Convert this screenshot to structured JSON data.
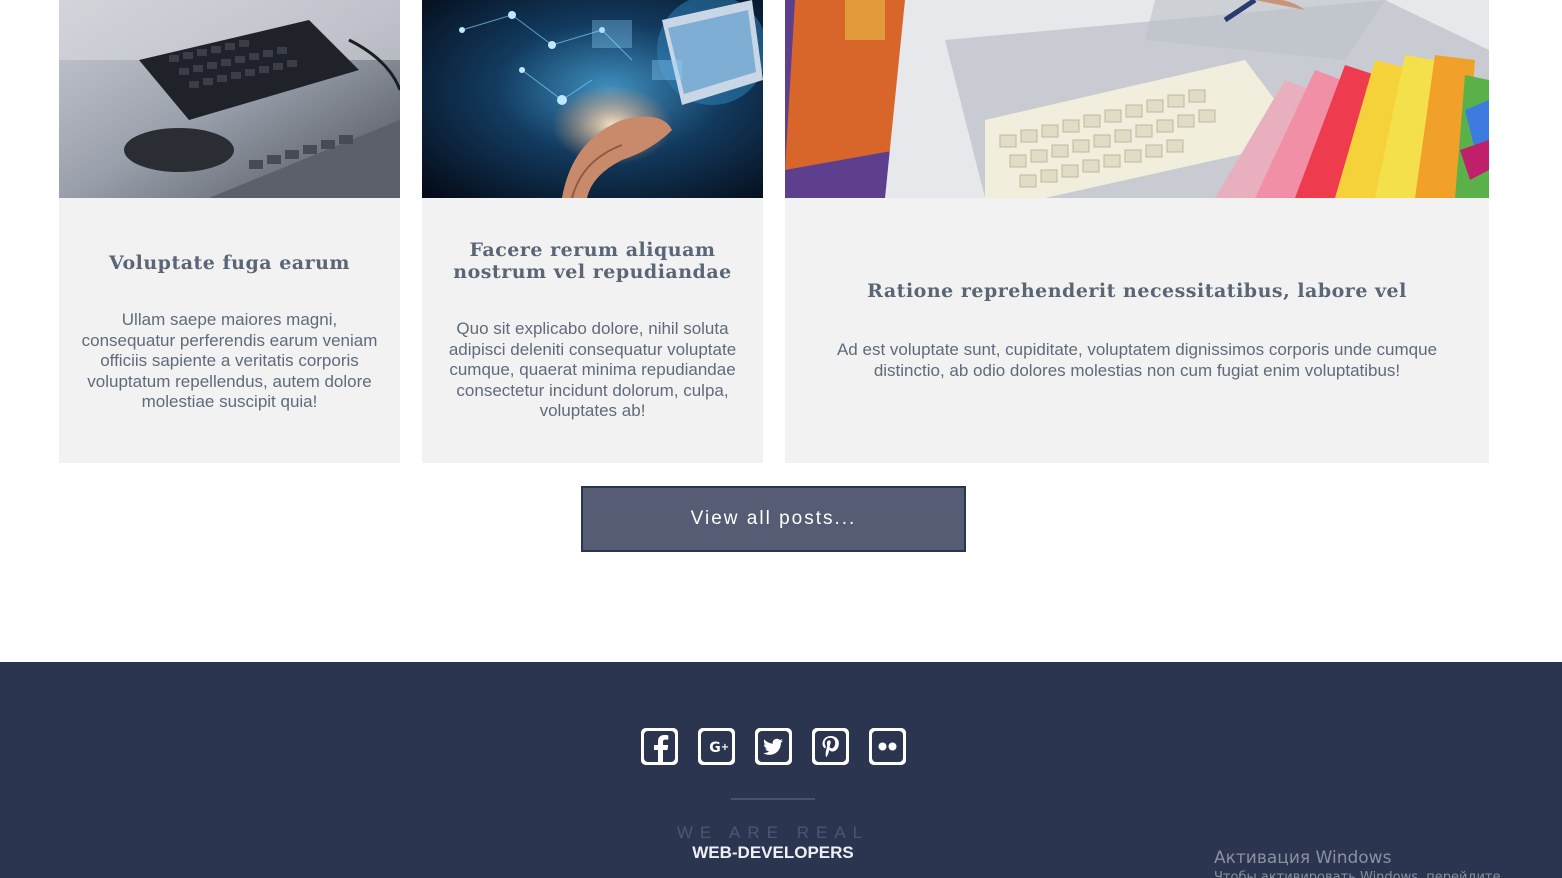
{
  "posts": [
    {
      "title": "Voluptate fuga earum",
      "excerpt": "Ullam saepe maiores magni, consequatur perferendis earum veniam officiis sapiente a veritatis corporis voluptatum repellendus, autem dolore molestiae suscipit quia!",
      "image": "keyboard-photo"
    },
    {
      "title": "Facere rerum aliquam nostrum vel repudiandae",
      "excerpt": "Quo sit explicabo dolore, nihil soluta adipisci deleniti consequatur voluptate cumque, quaerat minima repudiandae consectetur incidunt dolorum, culpa, voluptates ab!",
      "image": "hand-laptop-photo"
    },
    {
      "title": "Ratione reprehenderit necessitatibus, labore vel",
      "excerpt": "Ad est voluptate sunt, cupiditate, voluptatem dignissimos corporis unde cumque distinctio, ab odio dolores molestias non cum fugiat enim voluptatibus!",
      "image": "color-swatches-photo"
    }
  ],
  "view_all_label": "View all posts...",
  "footer": {
    "socials": [
      "facebook-icon",
      "google-plus-icon",
      "twitter-icon",
      "pinterest-icon",
      "flickr-icon"
    ],
    "tagline": "WE ARE REAL",
    "tagline_strong": "WEB-DEVELOPERS"
  },
  "windows_watermark": {
    "title": "Активация Windows",
    "subtitle": "Чтобы активировать Windows, перейдите"
  },
  "colors": {
    "card_bg": "#f2f2f2",
    "button_bg": "#555c74",
    "footer_bg": "#2c3550"
  }
}
